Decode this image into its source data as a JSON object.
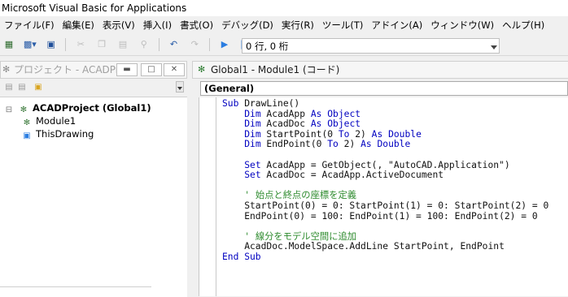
{
  "window": {
    "title": "Microsoft Visual Basic for Applications"
  },
  "menu": [
    "ファイル(F)",
    "編集(E)",
    "表示(V)",
    "挿入(I)",
    "書式(O)",
    "デバッグ(D)",
    "実行(R)",
    "ツール(T)",
    "アドイン(A)",
    "ウィンドウ(W)",
    "ヘルプ(H)"
  ],
  "toolbar": {
    "position_text": "0 行, 0 桁"
  },
  "project": {
    "title": "プロジェクト - ACADPro...",
    "root": "ACADProject (Global1)",
    "items": [
      "Module1",
      "ThisDrawing"
    ]
  },
  "code": {
    "title": "Global1 - Module1 (コード)",
    "object": "(General)"
  }
}
